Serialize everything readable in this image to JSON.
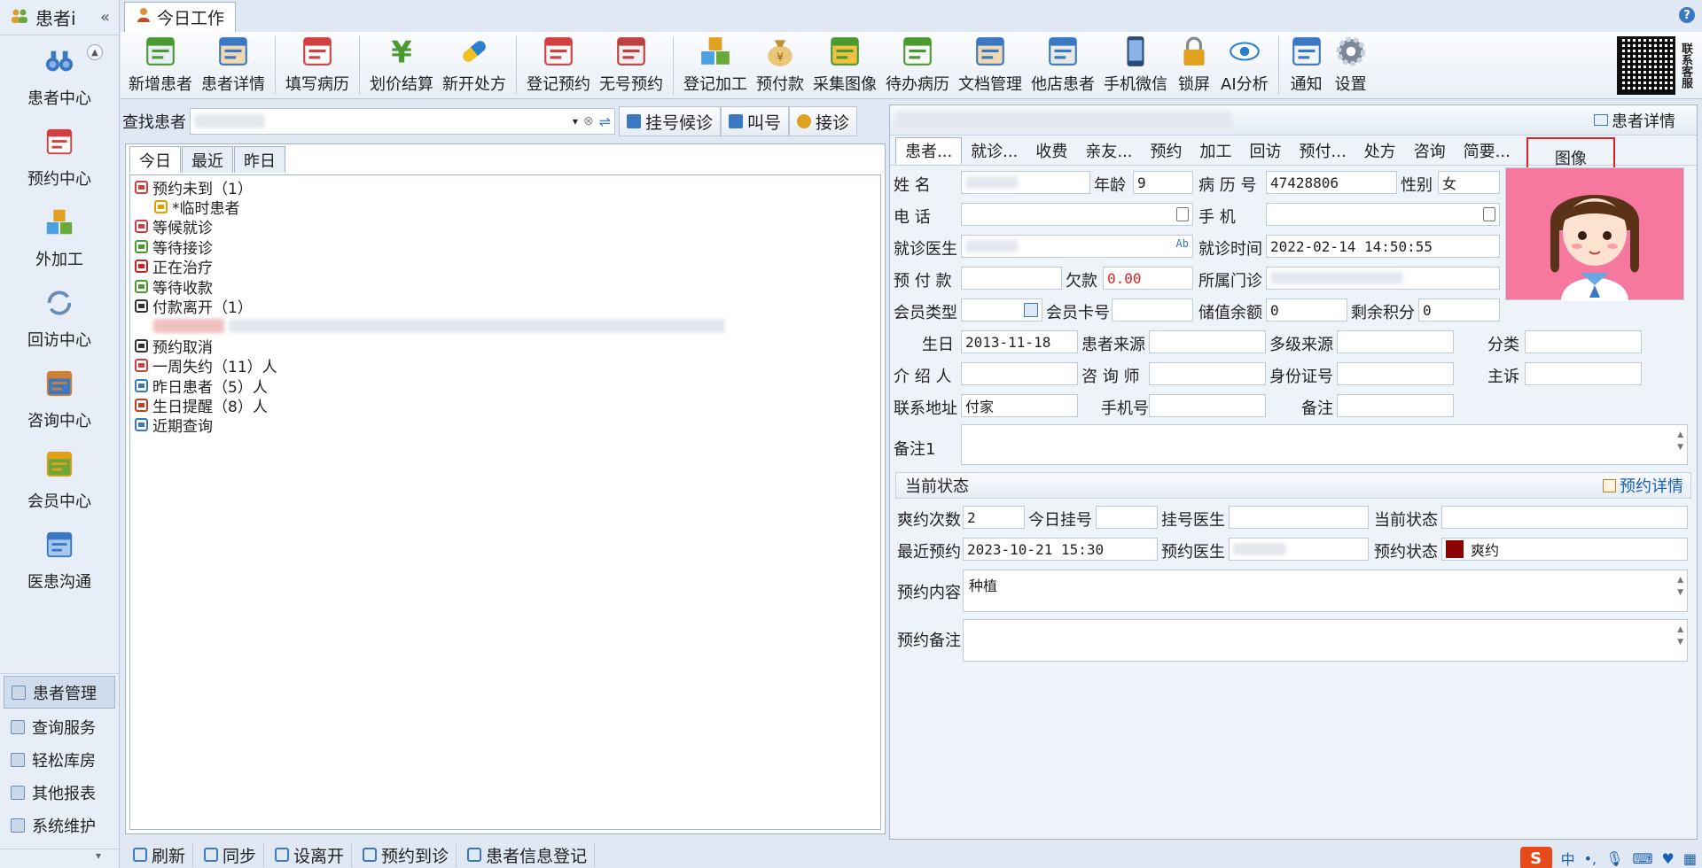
{
  "sidebar": {
    "title": "患者i",
    "collapse_icon": "«",
    "nav": [
      {
        "label": "患者中心",
        "icon": "binoculars-icon"
      },
      {
        "label": "预约中心",
        "icon": "calendar-icon"
      },
      {
        "label": "外加工",
        "icon": "cubes-icon"
      },
      {
        "label": "回访中心",
        "icon": "refresh-icon"
      },
      {
        "label": "咨询中心",
        "icon": "consult-icon"
      },
      {
        "label": "会员中心",
        "icon": "members-icon"
      },
      {
        "label": "医患沟通",
        "icon": "video-icon"
      }
    ],
    "groups": [
      {
        "label": "患者管理",
        "active": true
      },
      {
        "label": "查询服务",
        "active": false
      },
      {
        "label": "轻松库房",
        "active": false
      },
      {
        "label": "其他报表",
        "active": false
      },
      {
        "label": "系统维护",
        "active": false
      }
    ]
  },
  "tab": {
    "label": "今日工作"
  },
  "toolbar": {
    "groups": [
      [
        {
          "label": "新增患者",
          "icon": "add-patient-icon"
        },
        {
          "label": "患者详情",
          "icon": "patient-detail-icon"
        }
      ],
      [
        {
          "label": "填写病历",
          "icon": "medical-record-icon"
        }
      ],
      [
        {
          "label": "划价结算",
          "icon": "yuan-icon"
        },
        {
          "label": "新开处方",
          "icon": "pill-icon"
        }
      ],
      [
        {
          "label": "登记预约",
          "icon": "appointment-icon"
        },
        {
          "label": "无号预约",
          "icon": "calendar-grid-icon"
        }
      ],
      [
        {
          "label": "登记加工",
          "icon": "cubes-icon"
        },
        {
          "label": "预付款",
          "icon": "money-bag-icon"
        },
        {
          "label": "采集图像",
          "icon": "image-icon"
        },
        {
          "label": "待办病历",
          "icon": "checklist-icon"
        },
        {
          "label": "文档管理",
          "icon": "document-icon"
        },
        {
          "label": "他店患者",
          "icon": "other-store-icon"
        },
        {
          "label": "手机微信",
          "icon": "phone-icon"
        },
        {
          "label": "锁屏",
          "icon": "lock-icon"
        },
        {
          "label": "AI分析",
          "icon": "eye-icon"
        }
      ],
      [
        {
          "label": "通知",
          "icon": "notice-icon"
        },
        {
          "label": "设置",
          "icon": "gear-icon"
        }
      ]
    ],
    "qr_text": "联系客服"
  },
  "search": {
    "label": "查找患者",
    "buttons": [
      {
        "label": "挂号候诊",
        "icon": "queue-icon"
      },
      {
        "label": "叫号",
        "icon": "call-icon"
      },
      {
        "label": "接诊",
        "icon": "bulb-icon"
      }
    ]
  },
  "left_panel": {
    "tabs": [
      "今日",
      "最近",
      "昨日"
    ],
    "tree": [
      {
        "label": "预约未到（1）",
        "icon": "calendar-small-icon",
        "color": "#d04040",
        "child": false
      },
      {
        "label": "*临时患者",
        "icon": "mask-icon",
        "color": "#e0a000",
        "child": true
      },
      {
        "label": "等候就诊",
        "icon": "target-icon",
        "color": "#d04040",
        "child": false
      },
      {
        "label": "等待接诊",
        "icon": "users-icon",
        "color": "#4a9a30",
        "child": false
      },
      {
        "label": "正在治疗",
        "icon": "drop-icon",
        "color": "#d02020",
        "child": false
      },
      {
        "label": "等待收款",
        "icon": "yuan-small-icon",
        "color": "#4a9a30",
        "child": false
      },
      {
        "label": "付款离开（1）",
        "icon": "walk-icon",
        "color": "#333333",
        "child": false
      },
      {
        "label": "",
        "icon": "blurred-row",
        "color": "#e8a0a0",
        "child": true
      },
      {
        "label": "预约取消",
        "icon": "calendar-cancel-icon",
        "color": "#333333",
        "child": false
      },
      {
        "label": "一周失约（11）人",
        "icon": "calendar-week-icon",
        "color": "#d04040",
        "child": false
      },
      {
        "label": "昨日患者（5）人",
        "icon": "cycle-icon",
        "color": "#3b78c4",
        "child": false
      },
      {
        "label": "生日提醒（8）人",
        "icon": "cake-icon",
        "color": "#c04020",
        "child": false
      },
      {
        "label": "近期查询",
        "icon": "search-small-icon",
        "color": "#3b78c4",
        "child": false
      }
    ]
  },
  "right_panel": {
    "detail_link": "患者详情",
    "tabs": [
      "患者...",
      "就诊...",
      "收费",
      "亲友...",
      "预约",
      "加工",
      "回访",
      "预付...",
      "处方",
      "咨询",
      "简要...",
      "图像"
    ],
    "labels": {
      "name": "姓    名",
      "age": "年龄",
      "record_no": "病 历 号",
      "gender": "性别",
      "phone": "电    话",
      "mobile": "手    机",
      "doctor": "就诊医生",
      "visit_time": "就诊时间",
      "prepay": "预 付 款",
      "debt": "欠款",
      "clinic": "所属门诊",
      "member_type": "会员类型",
      "card_no": "会员卡号",
      "stored": "储值余额",
      "points": "剩余积分",
      "birthday": "生日",
      "source": "患者来源",
      "multi_source": "多级来源",
      "category": "分类",
      "referrer": "介 绍 人",
      "consultant": "咨 询 师",
      "id_no": "身份证号",
      "complaint": "主诉",
      "address": "联系地址",
      "cellphone": "手机号",
      "note": "备注",
      "note1": "备注1"
    },
    "values": {
      "age": "9",
      "record_no": "47428806",
      "gender": "女",
      "visit_time": "2022-02-14 14:50:55",
      "debt": "0.00",
      "stored": "0",
      "points": "0",
      "birthday": "2013-11-18",
      "address": "付家"
    },
    "status": {
      "title": "当前状态",
      "link": "预约详情",
      "labels": {
        "miss_count": "爽约次数",
        "today_reg": "今日挂号",
        "reg_doctor": "挂号医生",
        "current": "当前状态",
        "last_appt": "最近预约",
        "appt_doctor": "预约医生",
        "appt_status": "预约状态",
        "appt_content": "预约内容",
        "appt_note": "预约备注"
      },
      "values": {
        "miss_count": "2",
        "last_appt": "2023-10-21 15:30",
        "appt_status": "爽约",
        "appt_content": "种植"
      },
      "status_color": "#8b0000"
    }
  },
  "statusbar": [
    {
      "label": "刷新",
      "icon": "refresh-small-icon"
    },
    {
      "label": "同步",
      "icon": "sync-icon"
    },
    {
      "label": "设离开",
      "icon": "walk-icon"
    },
    {
      "label": "预约到诊",
      "icon": "arrive-icon"
    },
    {
      "label": "患者信息登记",
      "icon": "register-icon"
    }
  ],
  "ime": {
    "logo": "S",
    "mode": "中"
  }
}
